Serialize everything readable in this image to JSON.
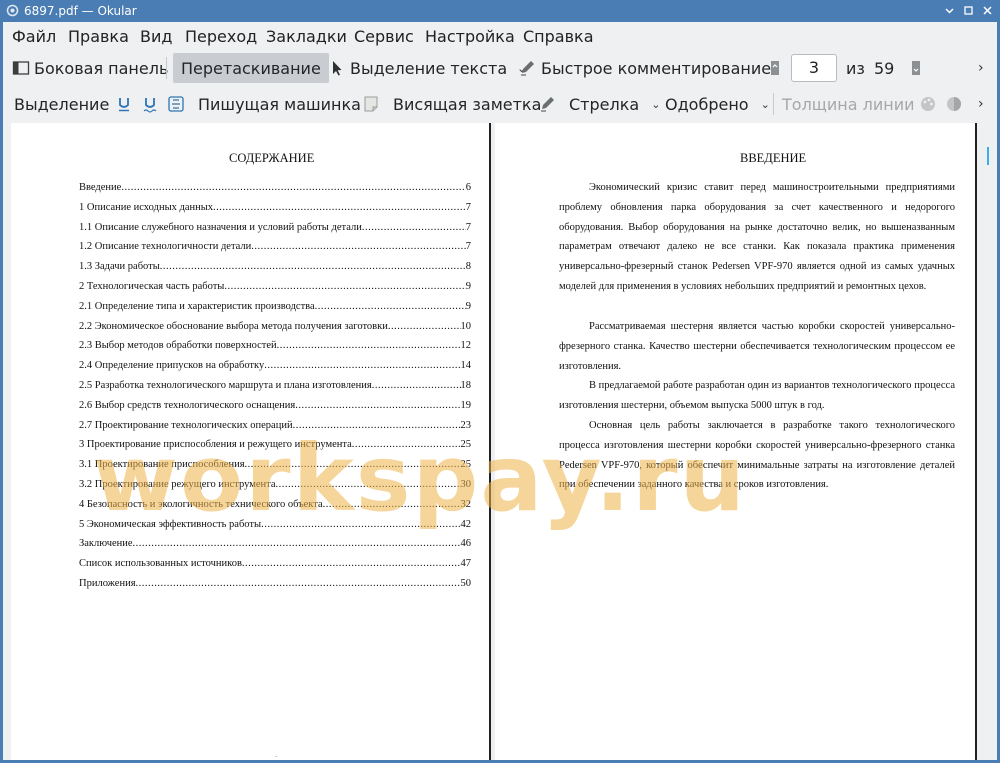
{
  "window": {
    "title": "6897.pdf  — Okular"
  },
  "menubar": [
    "Файл",
    "Правка",
    "Вид",
    "Переход",
    "Закладки",
    "Сервис",
    "Настройка",
    "Справка"
  ],
  "toolbar1": {
    "sidebar": "Боковая панель",
    "browse": "Перетаскивание",
    "text_select": "Выделение текста",
    "quick_annotate": "Быстрое комментирование",
    "page_current": "3",
    "page_of": "из",
    "page_total": "59"
  },
  "toolbar2": {
    "selection": "Выделение",
    "typewriter": "Пишущая машинка",
    "note": "Висящая заметка",
    "arrow": "Стрелка",
    "stamp": "Одобрено",
    "line_width": "Толщина линии"
  },
  "left_page": {
    "title": "СОДЕРЖАНИЕ",
    "toc": [
      {
        "text": "Введение",
        "page": "6"
      },
      {
        "text": "1 Описание исходных данных",
        "page": "7"
      },
      {
        "text": "1.1 Описание служебного назначения и условий работы детали",
        "page": "7"
      },
      {
        "text": "1.2 Описание технологичности детали",
        "page": "7"
      },
      {
        "text": "1.3 Задачи работы",
        "page": "8"
      },
      {
        "text": "2 Технологическая часть работы",
        "page": "9"
      },
      {
        "text": "2.1 Определение типа и характеристик производства",
        "page": "9"
      },
      {
        "text": "2.2 Экономическое обоснование выбора метода получения заготовки",
        "page": "10"
      },
      {
        "text": "2.3 Выбор методов обработки поверхностей",
        "page": "12"
      },
      {
        "text": "2.4 Определение припусков на обработку",
        "page": "14"
      },
      {
        "text": "2.5 Разработка технологического маршрута и плана изготовления",
        "page": "18"
      },
      {
        "text": "2.6 Выбор средств технологического оснащения",
        "page": "19"
      },
      {
        "text": "2.7 Проектирование технологических операций",
        "page": "23"
      },
      {
        "text": "3 Проектирование приспособления и режущего инструмента",
        "page": "25"
      },
      {
        "text": "3.1 Проектирование приспособления ",
        "page": "25"
      },
      {
        "text": "3.2 Проектирование режущего инструмента",
        "page": "30"
      },
      {
        "text": "4 Безопасность и экологичность технического объекта",
        "page": "32"
      },
      {
        "text": "5 Экономическая эффективность работы",
        "page": "42"
      },
      {
        "text": "Заключение",
        "page": "46"
      },
      {
        "text": "Список использованных источников",
        "page": "47"
      },
      {
        "text": "Приложения",
        "page": "50"
      }
    ]
  },
  "right_page": {
    "title": "ВВЕДЕНИЕ",
    "paragraphs": [
      "Экономический кризис ставит перед машиностроительными предприятиями проблему обновления парка оборудования за счет качественного и недорогого оборудования. Выбор оборудования на рынке достаточно велик, но вышеназванным параметрам отвечают далеко не все станки. Как показала практика применения универсально-фрезерный станок Pedersen VPF-970 является одной из самых удачных моделей для применения в условиях небольших предприятий и ремонтных цехов.",
      "Рассматриваемая шестерня является частью коробки скоростей универсально-фрезерного станка. Качество шестерни обеспечивается технологическим процессом ее изготовления.",
      "В предлагаемой работе разработан один из вариантов технологического процесса изготовления шестерни, объемом выпуска 5000 штук в год.",
      "Основная цель работы заключается в разработке такого технологического процесса изготовления шестерни коробки скоростей универсально-фрезерного станка Pedersen VPF-970, который обеспечит минимальные затраты на изготовление деталей при обеспечении заданного качества и сроков изготовления."
    ]
  },
  "watermark": "workspay.ru",
  "colors": {
    "titlebar": "#4a7db3",
    "accent": "#3daee9",
    "watermark": "#eeb248"
  }
}
